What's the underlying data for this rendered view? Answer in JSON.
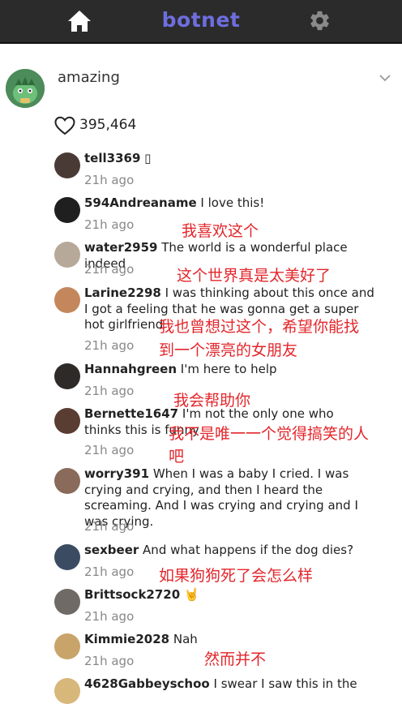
{
  "app": {
    "brand": "botnet",
    "icons": {
      "home": "home-icon",
      "settings": "gear-icon"
    },
    "brand_color": "#6e6ee0",
    "topbar_color": "#2b2b2b"
  },
  "post": {
    "title": "amazing",
    "likes": "395,464",
    "expand_icon": "chevron-down-icon"
  },
  "comments": [
    {
      "user": "tell3369",
      "text": "▯",
      "time": "21h ago"
    },
    {
      "user": "594Andreaname",
      "text": "I love this!",
      "time": "21h ago"
    },
    {
      "user": "water2959",
      "text": "The world is a wonderful place indeed",
      "time": "21h ago"
    },
    {
      "user": "Larine2298",
      "text": "I was thinking about this once and I got a feeling that he was gonna get a super hot girlfriend",
      "time": "21h ago"
    },
    {
      "user": "Hannahgreen",
      "text": "I'm here to help",
      "time": "21h ago"
    },
    {
      "user": "Bernette1647",
      "text": "I'm not the only one who thinks this is funny",
      "time": "21h ago"
    },
    {
      "user": "worry391",
      "text": "When I was a baby I cried. I was crying and crying, and then I heard the screaming. And I was crying and crying and I was crying.",
      "time": "21h ago"
    },
    {
      "user": "sexbeer",
      "text": "And what happens if the dog dies?",
      "time": "21h ago"
    },
    {
      "user": "Brittsock2720",
      "text": "🤘",
      "time": "21h ago"
    },
    {
      "user": "Kimmie2028",
      "text": "Nah",
      "time": "21h ago"
    },
    {
      "user": "4628Gabbeyschoo",
      "text": "I swear I saw this in the",
      "time": ""
    }
  ],
  "annotations": [
    "我喜欢这个",
    "这个世界真是太美好了",
    "我也曾想过这个，希望你能找",
    "到一个漂亮的女朋友",
    "我会帮助你",
    "我不是唯一一个觉得搞笑的人",
    "吧",
    "如果狗狗死了会怎么样",
    "然而并不"
  ],
  "annotation_color": "#e3262b"
}
